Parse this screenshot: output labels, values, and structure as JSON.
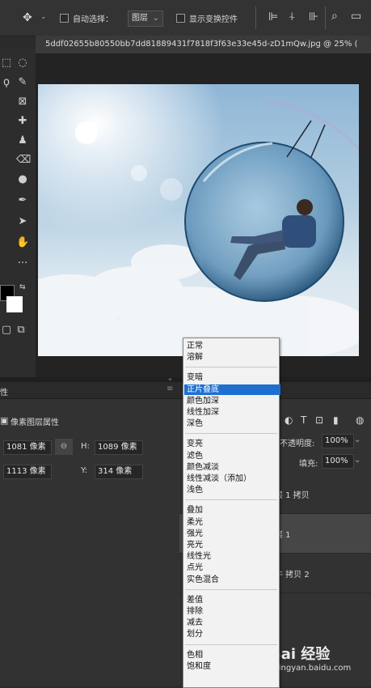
{
  "options_bar": {
    "auto_select_label": "自动选择：",
    "auto_select_value": "图层",
    "show_transform_label": "显示变换控件"
  },
  "document": {
    "tab_title": "5ddf02655b80550bb7dd81889431f7818f3f63e33e45d-zD1mQw.jpg @ 25% ("
  },
  "properties": {
    "tab_label": "性",
    "subtitle": "像素图层属性",
    "w_value": "1081 像素",
    "h_label": "H:",
    "h_value": "1089 像素",
    "x_value": "1113 像素",
    "y_label": "Y:",
    "y_value": "314 像素"
  },
  "layers": {
    "opacity_label": "不透明度:",
    "opacity_value": "100%",
    "fill_label": "填充:",
    "fill_value": "100%",
    "items": [
      {
        "label": "层 1 拷贝"
      },
      {
        "label": "层 1"
      },
      {
        "label": "牛 拷贝 2"
      }
    ]
  },
  "blend_menu": {
    "groups": [
      [
        "正常",
        "溶解"
      ],
      [
        "变暗",
        "正片叠底",
        "颜色加深",
        "线性加深",
        "深色"
      ],
      [
        "变亮",
        "滤色",
        "颜色减淡",
        "线性减淡（添加）",
        "浅色"
      ],
      [
        "叠加",
        "柔光",
        "强光",
        "亮光",
        "线性光",
        "点光",
        "实色混合"
      ],
      [
        "差值",
        "排除",
        "减去",
        "划分"
      ],
      [
        "色相",
        "饱和度"
      ]
    ],
    "selected": "正片叠底"
  },
  "watermark": {
    "text": "Bai 经验",
    "url": "jingyan.baidu.com"
  }
}
